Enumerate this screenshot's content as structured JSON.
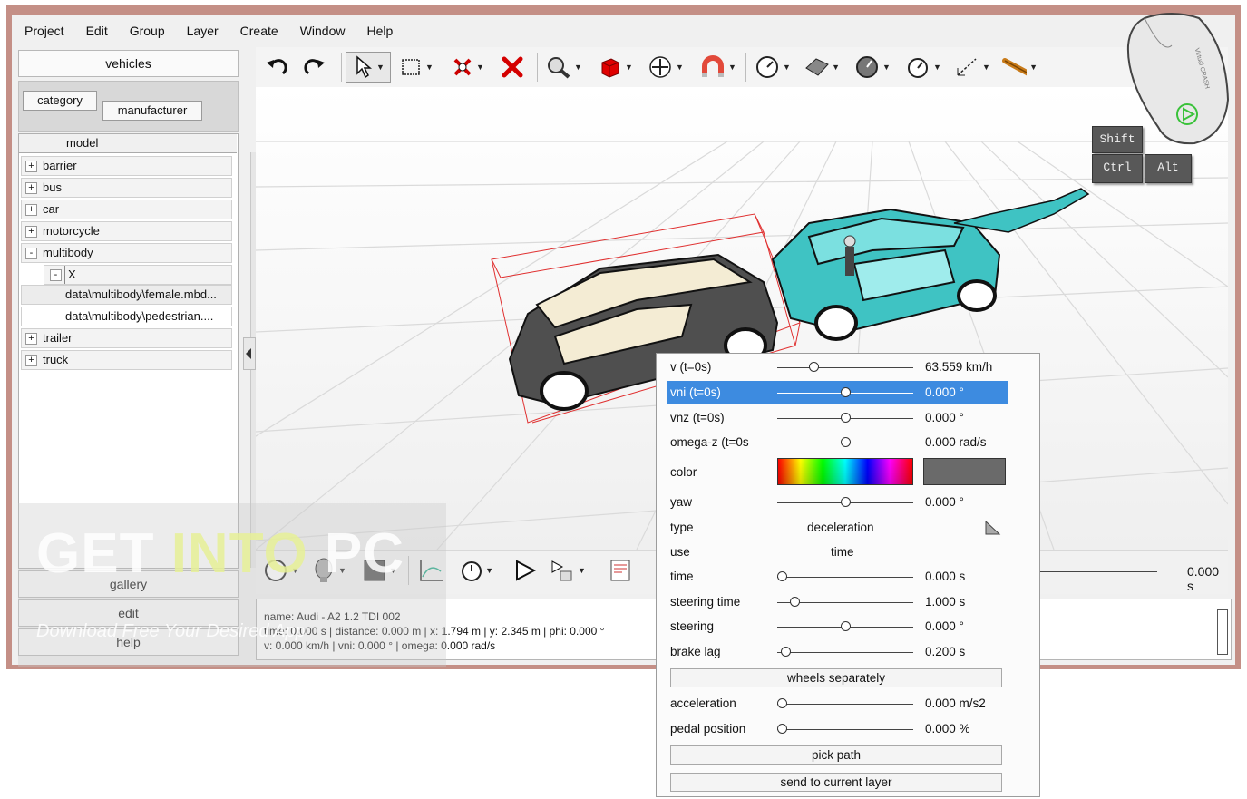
{
  "menu": [
    "Project",
    "Edit",
    "Group",
    "Layer",
    "Create",
    "Window",
    "Help"
  ],
  "left_panel": {
    "top_button": "vehicles",
    "tabs": {
      "category": "category",
      "manufacturer": "manufacturer"
    },
    "tree_header": "model",
    "tree": [
      {
        "sign": "+",
        "label": "barrier"
      },
      {
        "sign": "+",
        "label": "bus"
      },
      {
        "sign": "+",
        "label": "car"
      },
      {
        "sign": "+",
        "label": "motorcycle"
      },
      {
        "sign": "-",
        "label": "multibody"
      },
      {
        "sign": "-",
        "label": "X"
      },
      {
        "sign": "",
        "label": "data\\multibody\\female.mbd..."
      },
      {
        "sign": "",
        "label": "data\\multibody\\pedestrian...."
      },
      {
        "sign": "+",
        "label": "trailer"
      },
      {
        "sign": "+",
        "label": "truck"
      }
    ],
    "bottom_buttons": {
      "gallery": "gallery",
      "edit": "edit",
      "help": "help"
    }
  },
  "keyboard": {
    "shift": "Shift",
    "ctrl": "Ctrl",
    "alt": "Alt"
  },
  "mouse_text": "Virtual CRASH",
  "bottom_toolbar": {
    "time_value": "0.000 s"
  },
  "status": {
    "line1": "name: Audi - A2 1.2 TDI 002",
    "line2": "time: 0.000 s | distance: 0.000 m | x: 1.794 m | y: 2.345 m | phi: 0.000 °",
    "line3": "v: 0.000 km/h | vni: 0.000 ° | omega: 0.000 rad/s"
  },
  "panel": {
    "rows": {
      "v": {
        "label": "v (t=0s)",
        "value": "63.559 km/h"
      },
      "vni": {
        "label": "vni (t=0s)",
        "value": "0.000 °"
      },
      "vnz": {
        "label": "vnz (t=0s)",
        "value": "0.000 °"
      },
      "omega": {
        "label": "omega-z (t=0s",
        "value": "0.000 rad/s"
      },
      "color": {
        "label": "color"
      },
      "yaw": {
        "label": "yaw",
        "value": "0.000 °"
      },
      "type": {
        "label": "type",
        "value": "deceleration"
      },
      "use": {
        "label": "use",
        "value": "time"
      },
      "time": {
        "label": "time",
        "value": "0.000 s"
      },
      "steering_time": {
        "label": "steering time",
        "value": "1.000 s"
      },
      "steering": {
        "label": "steering",
        "value": "0.000 °"
      },
      "brake_lag": {
        "label": "brake lag",
        "value": "0.200 s"
      },
      "acceleration": {
        "label": "acceleration",
        "value": "0.000 m/s2"
      },
      "pedal": {
        "label": "pedal position",
        "value": "0.000 %"
      }
    },
    "buttons": {
      "wheels": "wheels separately",
      "pick_path": "pick path",
      "send": "send to current layer"
    },
    "slider_levels": {
      "v": 0.25,
      "vni": 0.5,
      "vnz": 0.5,
      "omega": 0.5,
      "yaw": 0.5,
      "time": 0.0,
      "steering_time": 0.1,
      "steering": 0.5,
      "brake_lag": 0.03,
      "acceleration": 0.0,
      "pedal": 0.0
    },
    "current_color": "#6a6a6a"
  },
  "watermark": {
    "title_a": "GET ",
    "title_b": "INTO",
    "title_c": " PC",
    "subtitle": "Download Free Your Desired App"
  },
  "colors": {
    "frame": "#c48f86",
    "selection": "#3d8be0",
    "teal_car": "#3fc3c3",
    "grey_car": "#4f4f4f"
  }
}
